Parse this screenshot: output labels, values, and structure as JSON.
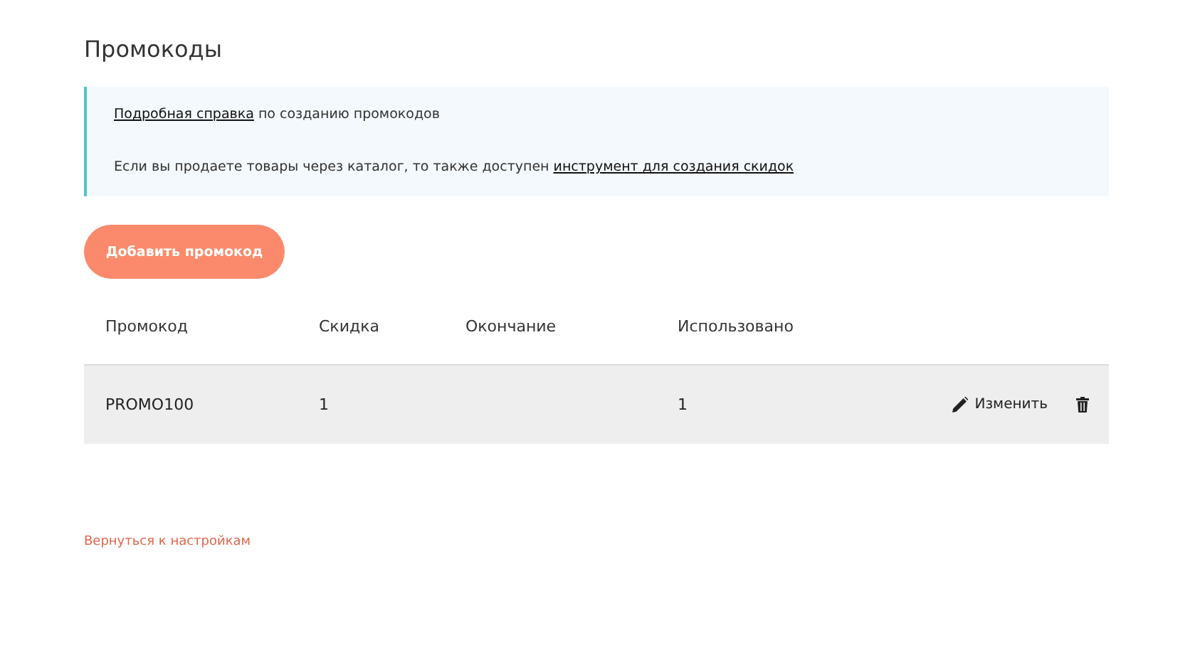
{
  "page": {
    "title": "Промокоды"
  },
  "info": [
    {
      "parts": [
        {
          "kind": "link",
          "text": "Подробная справка"
        },
        {
          "kind": "text",
          "text": " по созданию промокодов"
        }
      ]
    },
    {
      "parts": [
        {
          "kind": "text",
          "text": "Если вы продаете товары через каталог, то также доступен "
        },
        {
          "kind": "link",
          "text": "инструмент для создания скидок"
        }
      ]
    }
  ],
  "add_button": "Добавить промокод",
  "table": {
    "columns": [
      "Промокод",
      "Скидка",
      "Окончание",
      "Использовано"
    ],
    "rows": [
      {
        "cells": [
          "PROMO100",
          "1",
          "",
          "1"
        ],
        "edit": "Изменить"
      }
    ]
  },
  "back_link": "Вернуться к настройкам"
}
